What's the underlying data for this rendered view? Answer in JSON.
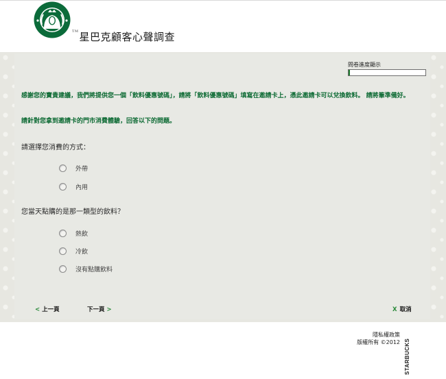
{
  "header": {
    "brand_title": "星巴克顧客心聲調查",
    "trademark": "TM"
  },
  "progress": {
    "label": "問卷進度顯示",
    "fraction": 0.02
  },
  "intro": {
    "paragraph": "感謝您的寶貴建議，我們將提供您一個「飲料優惠號碼」，請將「飲料優惠號碼」填寫在邀請卡上，憑此邀請卡可以兌換飲料。 請將筆準備好。",
    "instruction": "請針對您拿到邀請卡的門市消費體驗，回答以下的問題。"
  },
  "questions": [
    {
      "text": "請選擇您消費的方式：",
      "options": [
        "外帶",
        "內用"
      ]
    },
    {
      "text": "您當天點購的是那一類型的飲料？",
      "options": [
        "熱飲",
        "冷飲",
        "沒有點購飲料"
      ]
    }
  ],
  "nav": {
    "prev": "上一頁",
    "next": "下一頁",
    "cancel": "取消",
    "prev_chevron": "<",
    "next_chevron": ">",
    "cancel_mark": "X"
  },
  "footer": {
    "privacy": "隱私權政策",
    "copyright": "版權所有 ©2012",
    "wordmark": "STARBUCKS"
  },
  "colors": {
    "brand_green": "#0c6a33",
    "accent_green": "#2a8a3a",
    "panel": "#e8e9e4"
  }
}
